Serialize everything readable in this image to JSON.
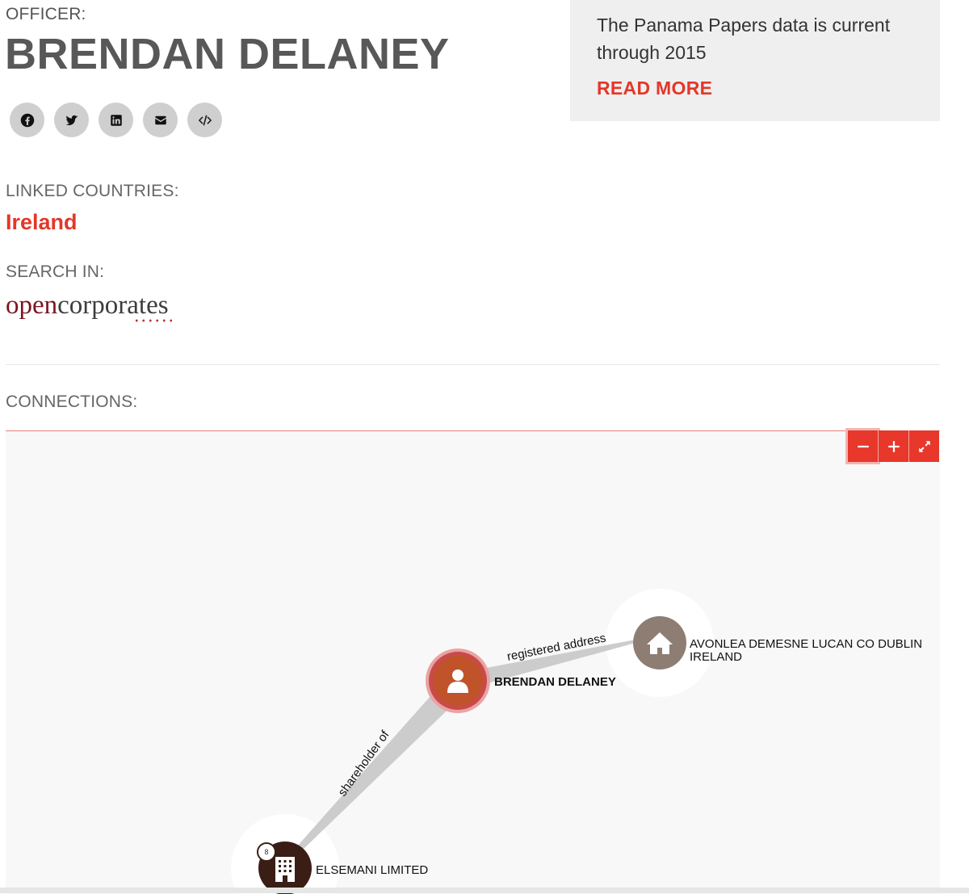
{
  "officer": {
    "label": "OFFICER:",
    "name": "BRENDAN DELANEY"
  },
  "share_buttons": [
    {
      "icon": "facebook-icon"
    },
    {
      "icon": "twitter-icon"
    },
    {
      "icon": "linkedin-icon"
    },
    {
      "icon": "email-icon"
    },
    {
      "icon": "embed-code-icon"
    }
  ],
  "info_box": {
    "text": "The Panama Papers data is current through 2015",
    "read_more": "READ MORE"
  },
  "linked_countries": {
    "label": "LINKED COUNTRIES:",
    "country": "Ireland"
  },
  "search_in": {
    "label": "SEARCH IN:",
    "logo_part1": "open",
    "logo_part2": "corporates"
  },
  "connections": {
    "label": "CONNECTIONS:",
    "zoom_out": "zoom-out-icon",
    "zoom_in": "zoom-in-icon",
    "fullscreen": "fullscreen-icon"
  },
  "graph": {
    "nodes": {
      "officer": {
        "label": "BRENDAN DELANEY",
        "icon": "person-icon",
        "color": "#c0532a"
      },
      "address": {
        "label_line1": "AVONLEA DEMESNE LUCAN CO DUBLIN",
        "label_line2": "IRELAND",
        "icon": "house-icon",
        "color": "#8e7d73"
      },
      "entity": {
        "label": "ELSEMANI LIMITED",
        "icon": "building-icon",
        "color": "#3a1e16",
        "badge": "8"
      }
    },
    "edges": {
      "address": "registered address",
      "entity": "shareholder of"
    }
  },
  "colors": {
    "accent": "#e3372a",
    "officer_node": "#c0532a",
    "address_node": "#8e7d73",
    "entity_node": "#3a1e16"
  }
}
